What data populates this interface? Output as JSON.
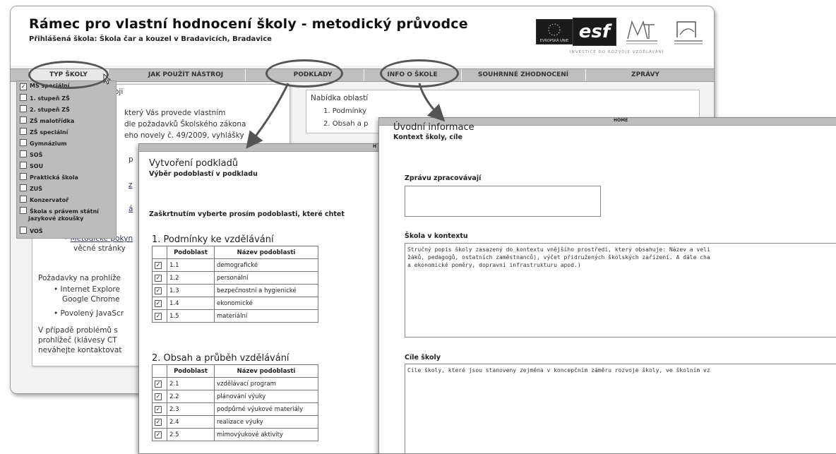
{
  "app": {
    "title": "Rámec pro vlastní hodnocení školy - metodický průvodce",
    "school_line": "Přihlášená škola: Škola čar a kouzel v Bradavicích, Bradavice",
    "logo_eu_caption": "EVROPSKÁ UNIE",
    "logo_esf": "esf",
    "investice": "INVESTICE DO ROZVOJE VZDĚLÁVÁNÍ"
  },
  "nav": [
    {
      "label": "TYP ŠKOLY"
    },
    {
      "label": "JAK POUŽÍT NÁSTROJ"
    },
    {
      "label": "PODKLADY"
    },
    {
      "label": "INFO O ŠKOLE"
    },
    {
      "label": "SOUHRNNÉ ZHODNOCENÍ"
    },
    {
      "label": "ZPRÁVY"
    }
  ],
  "school_types": [
    {
      "label": "MŠ speciální",
      "checked": true
    },
    {
      "label": "1. stupeň ZŠ",
      "checked": false
    },
    {
      "label": "2. stupeň ZŠ",
      "checked": false
    },
    {
      "label": "ZŠ malotřídka",
      "checked": false
    },
    {
      "label": "ZŠ speciální",
      "checked": false
    },
    {
      "label": "Gymnázium",
      "checked": false
    },
    {
      "label": "SOŠ",
      "checked": false
    },
    {
      "label": "SOU",
      "checked": false
    },
    {
      "label": "Praktická škola",
      "checked": false
    },
    {
      "label": "ZUŠ",
      "checked": false
    },
    {
      "label": "Konzervatoř",
      "checked": false
    },
    {
      "label": "Škola s právem státní",
      "label2": "jazykové zkoušky",
      "checked": false
    },
    {
      "label": "VOŠ",
      "checked": false
    }
  ],
  "left_panel": {
    "heading_fragment": "oji",
    "para1": [
      "který   Vás    provede    vlastním",
      "dle  požadavků  Školského  zákona",
      "eho  novely  č.  49/2009,  vyhlášky"
    ],
    "frag_p": "p",
    "frag_z": "z",
    "frag_a": "á",
    "bullet_link": "Metodické  pokyn",
    "bullet_rest": "věcné stránky",
    "req_text": "Požadavky na prohlíže",
    "req_items": [
      "Internet Explore",
      "Google Chrome",
      "Povolený JavaScr"
    ],
    "problem_lines": [
      "V případě problémů s",
      "prohlížeč (klávesy CT",
      "neváhejte kontaktovat"
    ]
  },
  "right_panel": {
    "title": "Nabídka oblastí",
    "items": [
      "1. Podmínky",
      "2. Obsah a p"
    ]
  },
  "podklady": {
    "title": "Vytvoření podkladů",
    "subtitle": "Výběr podoblastí v podkladu",
    "instruction": "Zaškrtnutím vyberte prosím podoblasti, které chtet",
    "header_col1": "Podoblast",
    "header_col2": "Název podoblasti",
    "section1": {
      "title": "1. Podmínky ke vzdělávání",
      "rows": [
        {
          "code": "1.1",
          "name": "demografické",
          "checked": true
        },
        {
          "code": "1.2",
          "name": "personální",
          "checked": true
        },
        {
          "code": "1.3",
          "name": "bezpečnostní a hygienické",
          "checked": true
        },
        {
          "code": "1.4",
          "name": "ekonomické",
          "checked": true
        },
        {
          "code": "1.5",
          "name": "materiální",
          "checked": true
        }
      ]
    },
    "section2": {
      "title": "2. Obsah a průběh vzdělávání",
      "rows": [
        {
          "code": "2.1",
          "name": "vzdělávací program",
          "checked": true
        },
        {
          "code": "2.2",
          "name": "plánování výuky",
          "checked": true
        },
        {
          "code": "2.3",
          "name": "podpůrné výukové materiály",
          "checked": true
        },
        {
          "code": "2.4",
          "name": "realizace výuky",
          "checked": true
        },
        {
          "code": "2.5",
          "name": "mimovýukové aktivity",
          "checked": true
        }
      ]
    }
  },
  "uvodni": {
    "topbar": "HOME",
    "title": "Úvodní informace",
    "subtitle": "Kontext školy, cíle",
    "label_zprava": "Zprávu zpracovávají",
    "zprava_value": "",
    "label_kontext": "Škola v kontextu",
    "kontext_value": "Stručný popis školy zasazený do kontextu vnějšího prostředí, který obsahuje: Název a veli\nžáků, pedagogů, ostatních zaměstnanců), výčet přidružených školských zařízení. A dále cha\na ekonomické poměry, dopravní infrastrukturu apod.)",
    "label_cile": "Cíle školy",
    "cile_value": "Cíle školy, které jsou stanoveny zejména v koncepčním záměru rozvoje školy, ve školním vz"
  },
  "colors": {
    "navbar": "#bfbfbf",
    "dropdown": "#bcbcbc",
    "annotation": "#555555"
  }
}
